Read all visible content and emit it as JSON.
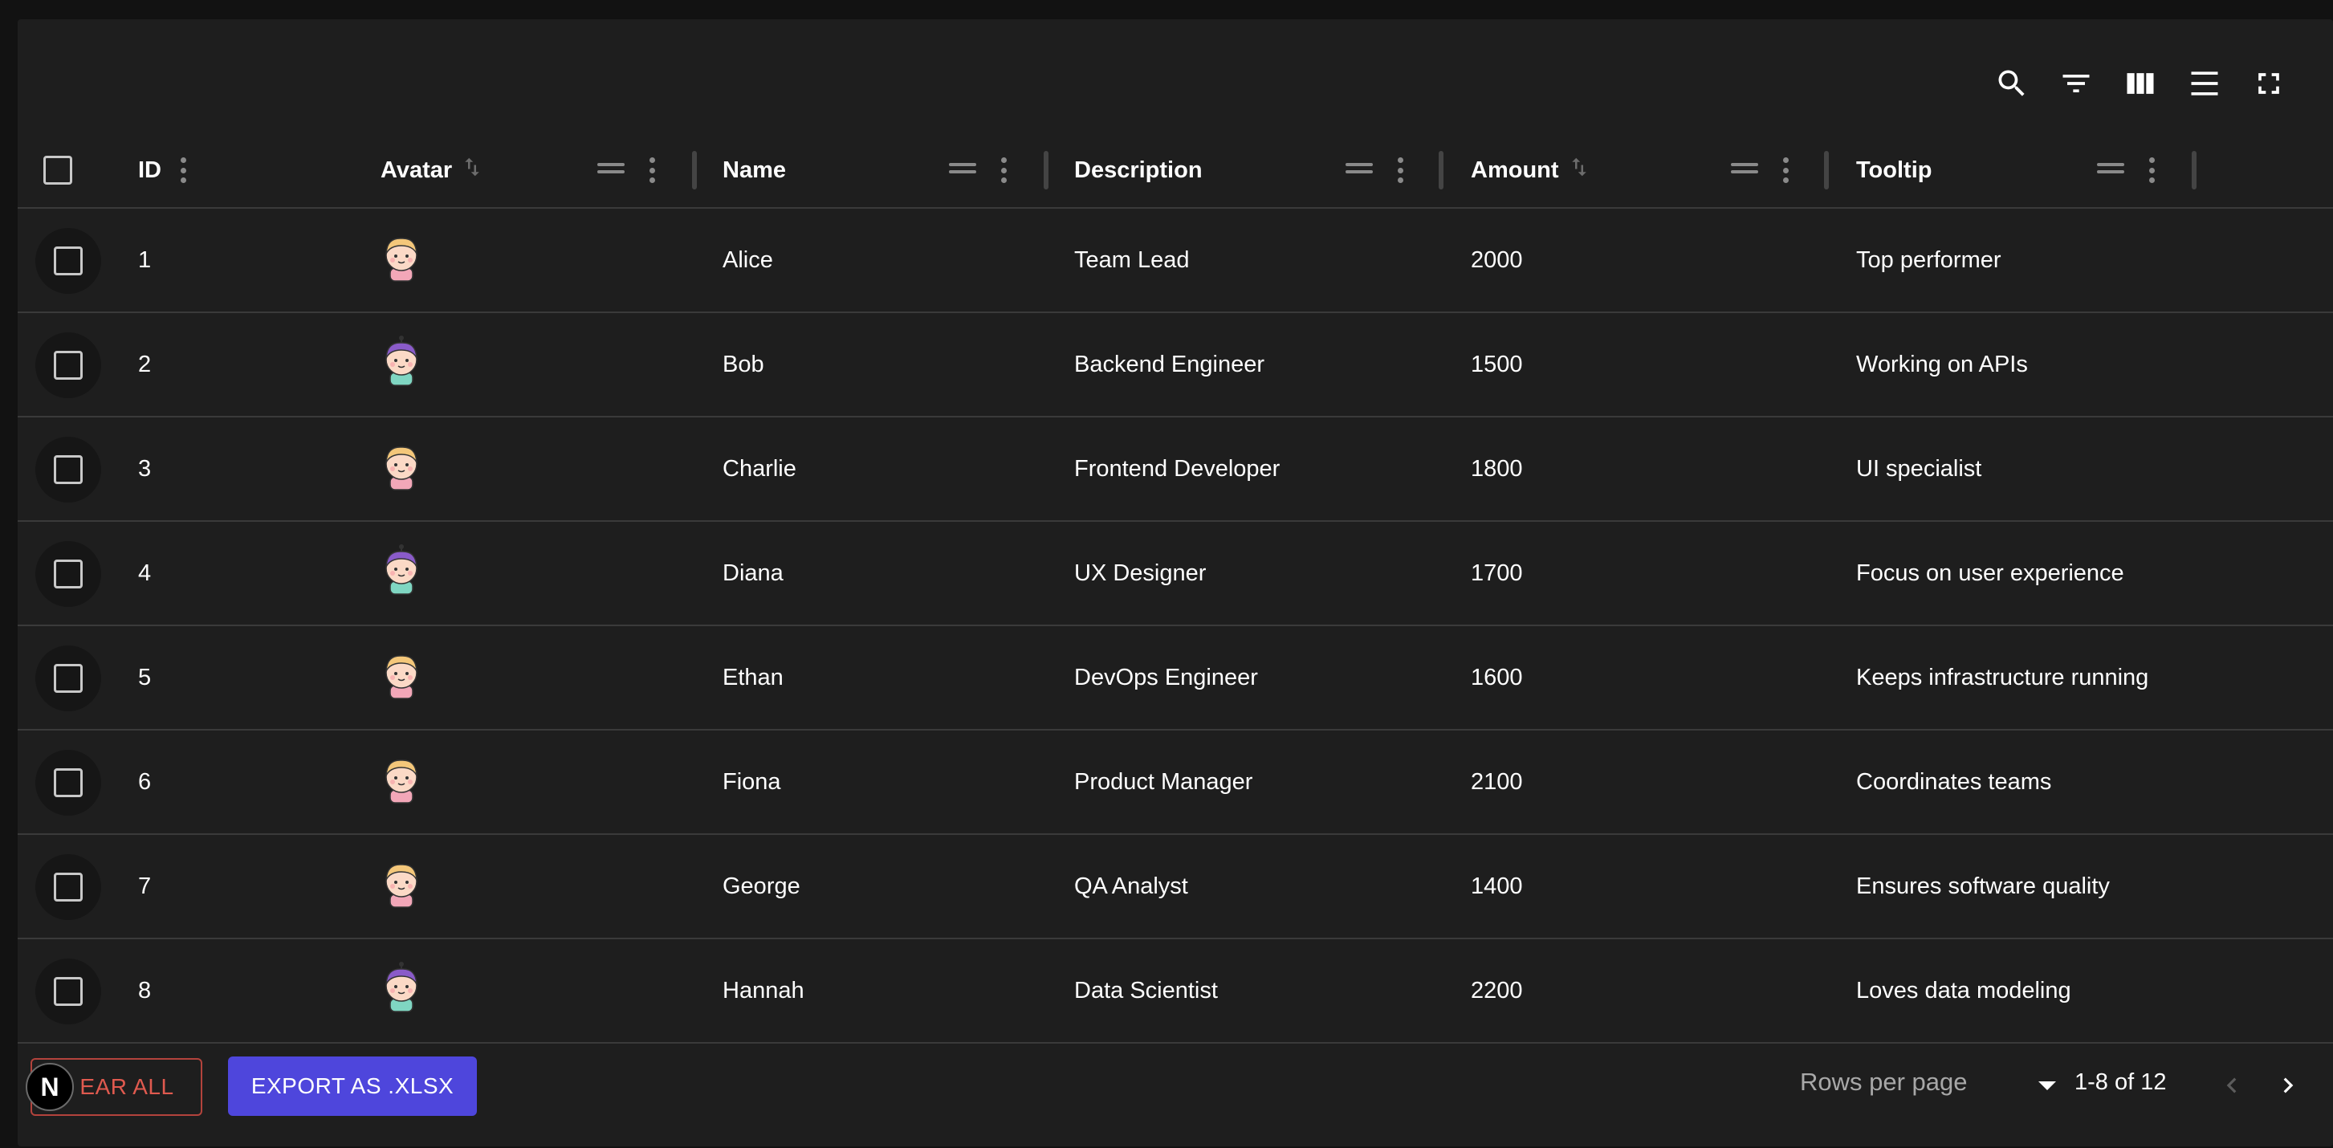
{
  "toolbar": {
    "icons": [
      "search-icon",
      "filter-icon",
      "columns-icon",
      "density-icon",
      "fullscreen-icon"
    ]
  },
  "columns": [
    {
      "key": "id",
      "label": "ID"
    },
    {
      "key": "avatar",
      "label": "Avatar"
    },
    {
      "key": "name",
      "label": "Name"
    },
    {
      "key": "description",
      "label": "Description"
    },
    {
      "key": "amount",
      "label": "Amount"
    },
    {
      "key": "tooltip",
      "label": "Tooltip"
    }
  ],
  "rows": [
    {
      "id": "1",
      "avatar": "avatar-blonde",
      "name": "Alice",
      "description": "Team Lead",
      "amount": "2000",
      "tooltip": "Top performer"
    },
    {
      "id": "2",
      "avatar": "avatar-purple",
      "name": "Bob",
      "description": "Backend Engineer",
      "amount": "1500",
      "tooltip": "Working on APIs"
    },
    {
      "id": "3",
      "avatar": "avatar-blonde",
      "name": "Charlie",
      "description": "Frontend Developer",
      "amount": "1800",
      "tooltip": "UI specialist"
    },
    {
      "id": "4",
      "avatar": "avatar-purple",
      "name": "Diana",
      "description": "UX Designer",
      "amount": "1700",
      "tooltip": "Focus on user experience"
    },
    {
      "id": "5",
      "avatar": "avatar-blonde",
      "name": "Ethan",
      "description": "DevOps Engineer",
      "amount": "1600",
      "tooltip": "Keeps infrastructure running"
    },
    {
      "id": "6",
      "avatar": "avatar-blonde",
      "name": "Fiona",
      "description": "Product Manager",
      "amount": "2100",
      "tooltip": "Coordinates teams"
    },
    {
      "id": "7",
      "avatar": "avatar-blonde",
      "name": "George",
      "description": "QA Analyst",
      "amount": "1400",
      "tooltip": "Ensures software quality"
    },
    {
      "id": "8",
      "avatar": "avatar-purple",
      "name": "Hannah",
      "description": "Data Scientist",
      "amount": "2200",
      "tooltip": "Loves data modeling"
    }
  ],
  "footer": {
    "clear_label": "EAR ALL",
    "export_label": "EXPORT AS .XLSX",
    "badge_letter": "N",
    "rows_per_page_label": "Rows per page",
    "range_text": "1-8 of 12"
  },
  "colors": {
    "background": "#1e1e1e",
    "accent": "#4e46dc",
    "danger": "#e05a4f",
    "avatar_blonde_hair": "#f4c77a",
    "avatar_purple_hair": "#8a5bc9"
  }
}
